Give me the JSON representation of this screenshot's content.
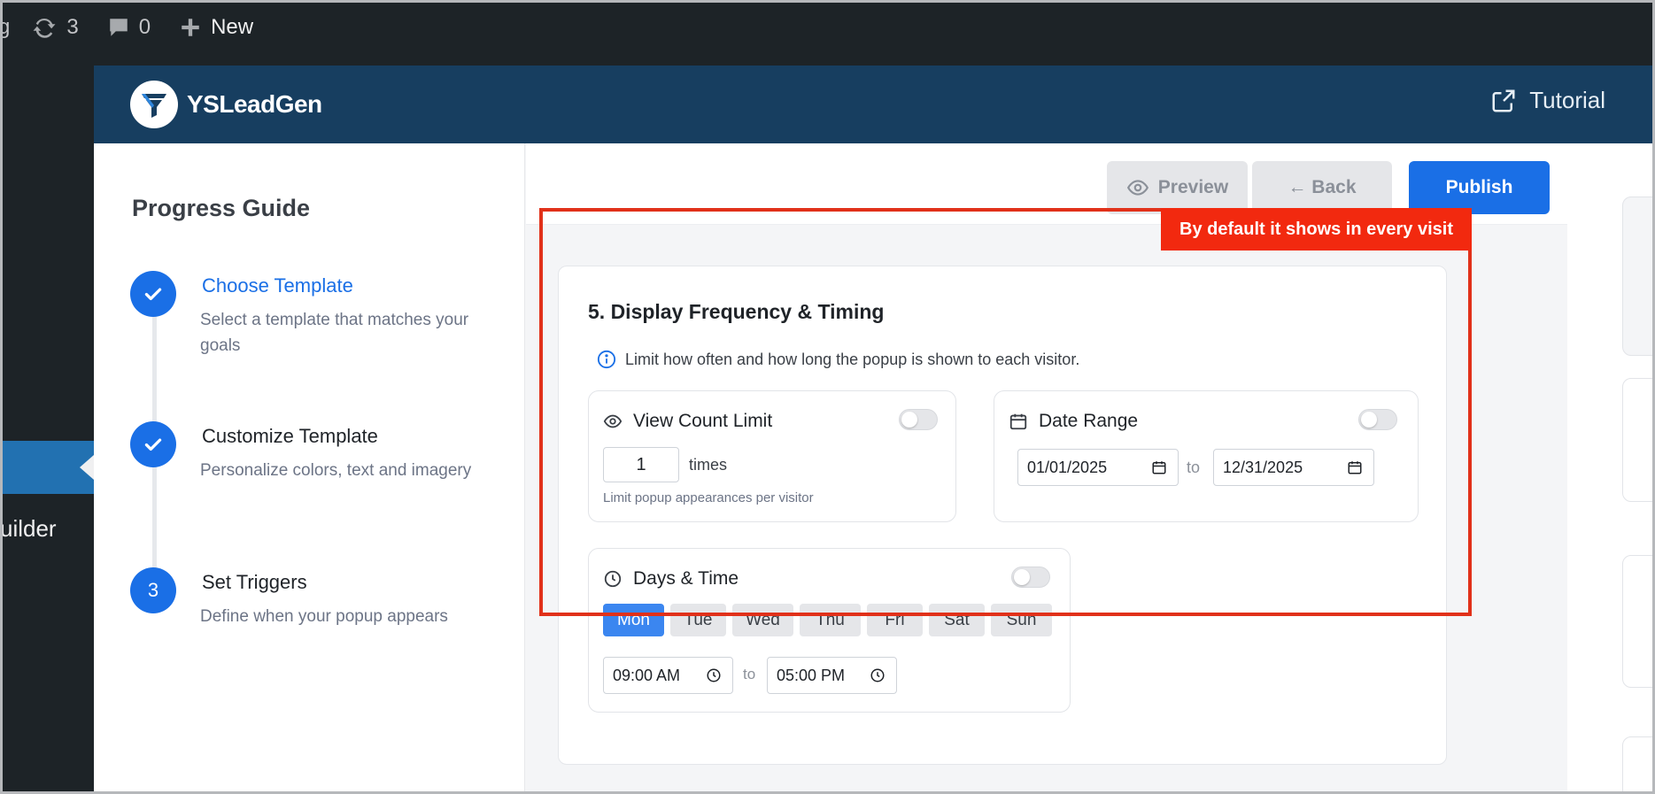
{
  "adminbar": {
    "site_partial": "g",
    "updates_count": "3",
    "comments_count": "0",
    "new_label": "New"
  },
  "wpmenu": {
    "builder_partial": "uilder",
    "e_partial": "e"
  },
  "header": {
    "brand": "YSLeadGen",
    "tutorial_label": "Tutorial"
  },
  "guide": {
    "title": "Progress Guide",
    "steps": [
      {
        "marker": "",
        "status": "done",
        "title": "Choose Template",
        "desc": "Select a template that matches your goals"
      },
      {
        "marker": "",
        "status": "done",
        "title": "Customize Template",
        "desc": "Personalize colors, text and imagery"
      },
      {
        "marker": "3",
        "status": "current",
        "title": "Set Triggers",
        "desc": "Define when your popup appears"
      }
    ]
  },
  "toolbar": {
    "preview_label": "Preview",
    "back_label": "← Back",
    "publish_label": "Publish"
  },
  "section": {
    "title": "5. Display Frequency & Timing",
    "info": "Limit how often and how long the popup is shown to each visitor.",
    "view_count": {
      "title": "View Count Limit",
      "value": "1",
      "unit": "times",
      "hint": "Limit popup appearances per visitor",
      "enabled": false
    },
    "date_range": {
      "title": "Date Range",
      "start": "01/01/2025",
      "to_label": "to",
      "end": "12/31/2025",
      "enabled": false
    },
    "days_time": {
      "title": "Days & Time",
      "days": [
        "Mon",
        "Tue",
        "Wed",
        "Thu",
        "Fri",
        "Sat",
        "Sun"
      ],
      "selected_day": "Mon",
      "start_time": "09:00 AM",
      "to_label": "to",
      "end_time": "05:00 PM",
      "enabled": false
    }
  },
  "annotation": {
    "label": "By default it shows in every visit"
  },
  "colors": {
    "accent": "#1a6fe6",
    "header_bg": "#173e60",
    "annotation": "#f2290f"
  }
}
